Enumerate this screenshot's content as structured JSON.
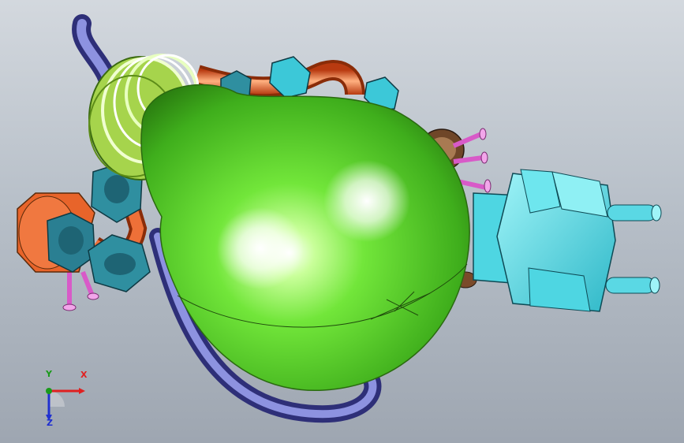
{
  "viewport": {
    "background_top": "#d3d8de",
    "background_bottom": "#9ea6b1"
  },
  "model": {
    "parts": [
      "bulb-glass",
      "coil-spring",
      "copper-pipe",
      "hex-nut",
      "screw",
      "power-plug",
      "brass-fitting",
      "purple-cable"
    ],
    "colors": {
      "bulb": "#6fe53c",
      "coil": "#c8f08a",
      "pipe": "#e8642a",
      "nut": "#2f8fa0",
      "nut_alt": "#3cc8d8",
      "screw": "#f08ae0",
      "plug": "#6ee6ee",
      "cable": "#7880d0",
      "fitting": "#8a5a3a"
    }
  },
  "triad": {
    "x_label": "X",
    "y_label": "Y",
    "z_label": "Z",
    "x_color": "#e02020",
    "y_color": "#1a9a1a",
    "z_color": "#2030d0"
  }
}
